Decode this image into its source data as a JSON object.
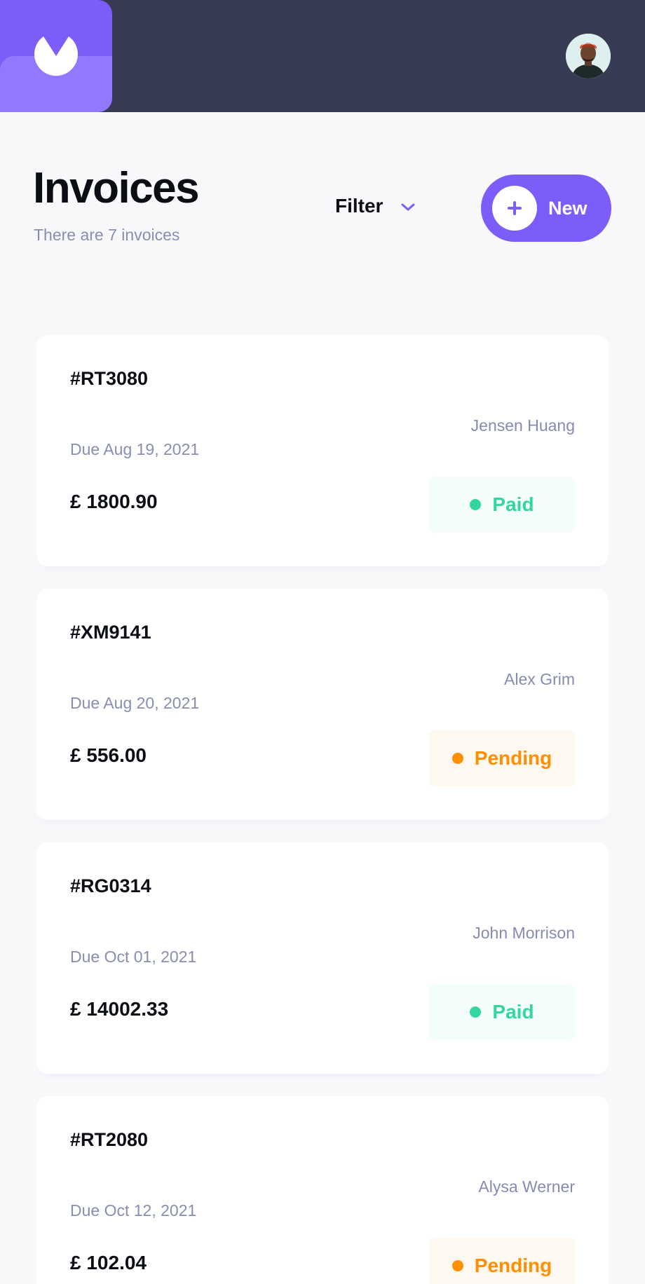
{
  "header": {
    "logo_icon": "app-logo-icon",
    "avatar_icon": "user-avatar",
    "colors": {
      "bar": "#373B53",
      "logo": "#7C5DFA",
      "logo_lower": "#9277FF"
    }
  },
  "page": {
    "title": "Invoices",
    "subtitle": "There are 7 invoices"
  },
  "toolbar": {
    "filter_label": "Filter",
    "filter_icon": "chevron-down-icon",
    "new_label": "New",
    "new_icon": "plus-icon",
    "accent": "#7C5DFA"
  },
  "invoices": [
    {
      "id": "#RT3080",
      "client": "Jensen Huang",
      "due": "Due Aug 19, 2021",
      "amount": "£ 1800.90",
      "status": "Paid"
    },
    {
      "id": "#XM9141",
      "client": "Alex Grim",
      "due": "Due Aug 20, 2021",
      "amount": "£ 556.00",
      "status": "Pending"
    },
    {
      "id": "#RG0314",
      "client": "John Morrison",
      "due": "Due Oct 01, 2021",
      "amount": "£ 14002.33",
      "status": "Paid"
    },
    {
      "id": "#RT2080",
      "client": "Alysa Werner",
      "due": "Due Oct 12, 2021",
      "amount": "£ 102.04",
      "status": "Pending"
    }
  ],
  "status_colors": {
    "Paid": "#33D69F",
    "Pending": "#FF8F00"
  }
}
